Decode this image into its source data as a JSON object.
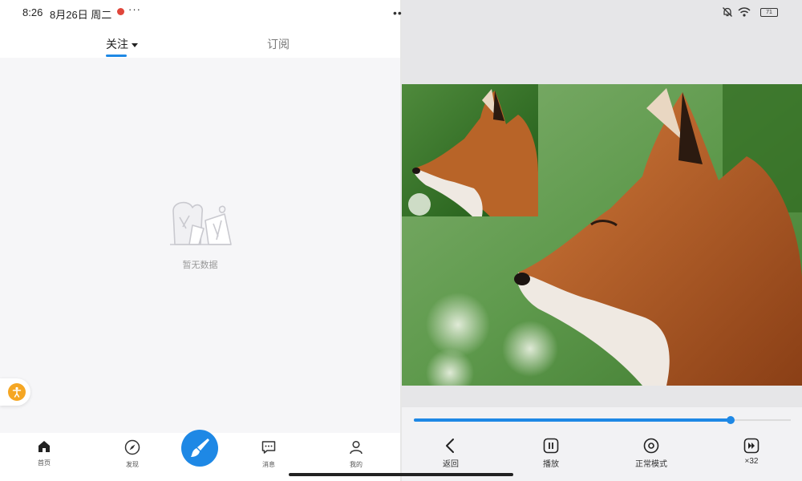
{
  "status_bar": {
    "time": "8:26",
    "date": "8月26日 周二",
    "more": "···",
    "battery": "71"
  },
  "left_app": {
    "tabs": [
      {
        "label": "关注",
        "active": true
      },
      {
        "label": "订阅",
        "active": false
      }
    ],
    "empty_state": {
      "text": "暂无数据"
    },
    "bottom_nav": [
      {
        "label": "首页",
        "icon": "home-icon"
      },
      {
        "label": "发现",
        "icon": "compass-icon"
      },
      {
        "label": "消息",
        "icon": "message-icon"
      },
      {
        "label": "我的",
        "icon": "person-icon"
      }
    ],
    "fab_icon": "brush-icon",
    "accent": "#1e88e5"
  },
  "split_handle": "•••",
  "right_app": {
    "playback": {
      "progress": 0.84
    },
    "controls": [
      {
        "label": "返回",
        "icon": "chevron-left-icon"
      },
      {
        "label": "播放",
        "icon": "pause-icon"
      },
      {
        "label": "正常模式",
        "icon": "target-icon"
      },
      {
        "label": "×32",
        "icon": "fast-forward-icon"
      }
    ]
  }
}
